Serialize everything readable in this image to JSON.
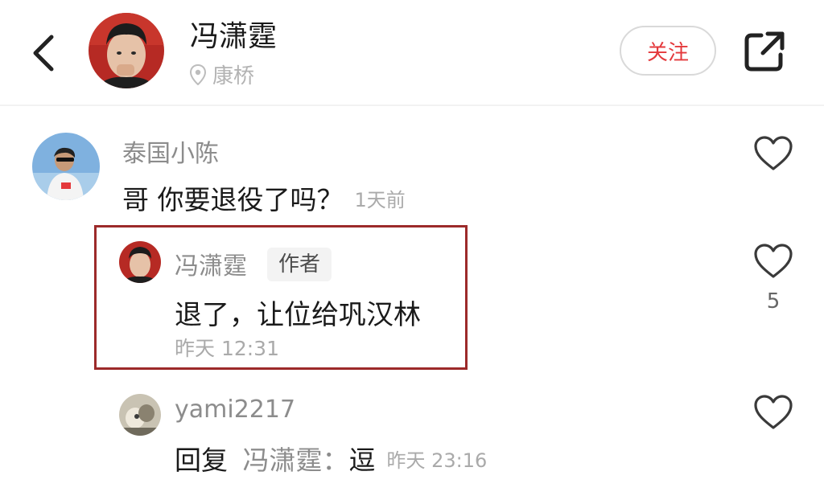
{
  "header": {
    "name": "冯潇霆",
    "location": "康桥",
    "follow_label": "关注"
  },
  "comments": [
    {
      "user": "泰国小陈",
      "text": "哥 你要退役了吗？",
      "time": "1天前",
      "replies": [
        {
          "user": "冯潇霆",
          "badge": "作者",
          "text": "退了，让位给巩汉林",
          "time": "昨天 12:31",
          "likes": "5"
        },
        {
          "user": "yami2217",
          "reply_prefix": "回复",
          "reply_to": "冯潇霆：",
          "text": "逗",
          "time": "昨天 23:16"
        }
      ]
    }
  ],
  "icons": {
    "back": "chevron-left-icon",
    "location": "location-pin-icon",
    "share": "share-icon",
    "like": "heart-outline-icon"
  },
  "colors": {
    "accent": "#e4393c",
    "highlight_border": "#9c2a2a",
    "secondary_text": "#8c8c8c"
  }
}
